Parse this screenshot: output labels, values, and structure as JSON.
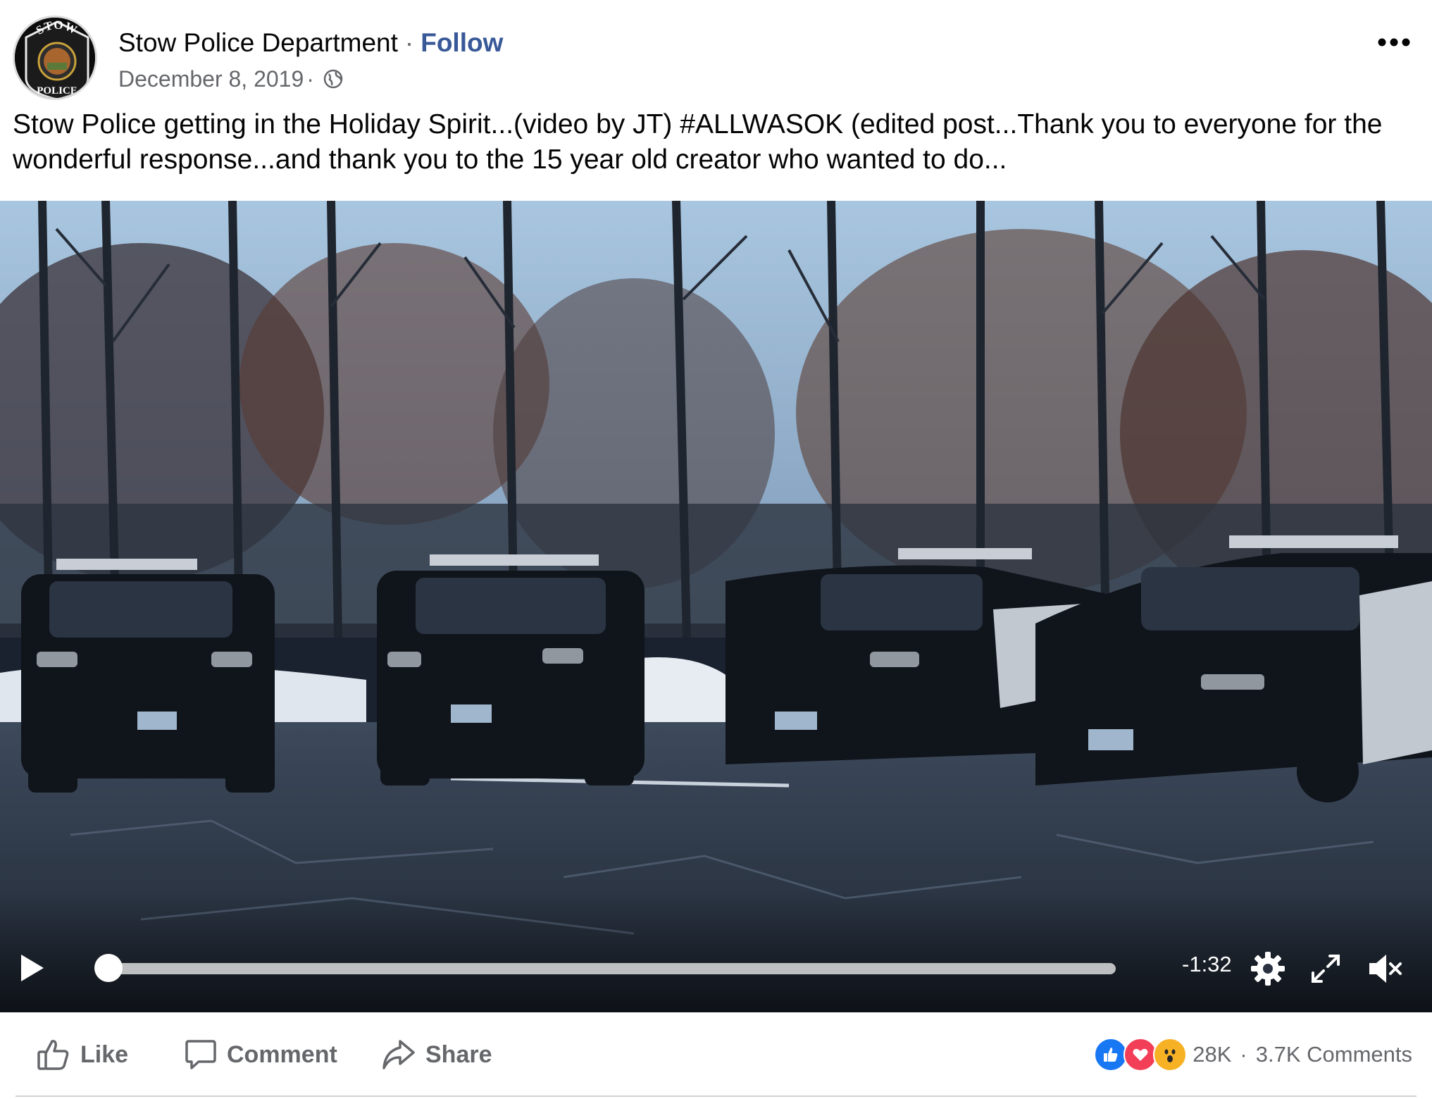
{
  "post": {
    "author": "Stow Police Department",
    "separator": "·",
    "follow_label": "Follow",
    "date": "December 8, 2019",
    "meta_separator": "·",
    "privacy_icon": "globe-icon",
    "more_icon": "more-horizontal-icon",
    "text": "Stow Police getting in the Holiday Spirit...(video by JT) #ALLWASOK (edited post...Thank you to everyone for the wonderful response...and thank you to the 15 year old creator who wanted to do..."
  },
  "avatar": {
    "top_text": "STOW",
    "bottom_text": "POLICE"
  },
  "video": {
    "time_remaining": "-1:32",
    "progress": 0,
    "play_icon": "play-icon",
    "settings_icon": "gear-icon",
    "fullscreen_icon": "fullscreen-icon",
    "volume_icon": "volume-muted-icon"
  },
  "actions": {
    "like_label": "Like",
    "comment_label": "Comment",
    "share_label": "Share"
  },
  "engagement": {
    "reaction_count": "28K",
    "separator": "·",
    "comments_count": "3.7K Comments",
    "reaction_types": [
      "like",
      "love",
      "wow"
    ]
  },
  "colors": {
    "follow_link": "#385898",
    "secondary_text": "#65676b",
    "like_blue": "#1877f2",
    "love_red": "#f33e58",
    "wow_yellow": "#f7b125"
  }
}
